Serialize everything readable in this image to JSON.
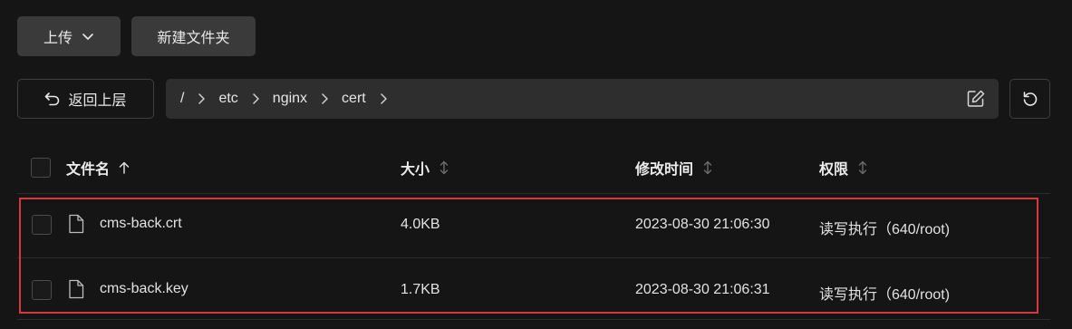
{
  "toolbar": {
    "upload_label": "上传",
    "new_folder_label": "新建文件夹"
  },
  "navigation": {
    "back_label": "返回上层",
    "breadcrumb": [
      "/",
      "etc",
      "nginx",
      "cert"
    ]
  },
  "table": {
    "headers": {
      "name": "文件名",
      "size": "大小",
      "modified": "修改时间",
      "permissions": "权限"
    },
    "rows": [
      {
        "name": "cms-back.crt",
        "size": "4.0KB",
        "modified": "2023-08-30 21:06:30",
        "permissions": "读写执行（640/root)"
      },
      {
        "name": "cms-back.key",
        "size": "1.7KB",
        "modified": "2023-08-30 21:06:31",
        "permissions": "读写执行（640/root)"
      }
    ]
  },
  "colors": {
    "background": "#151515",
    "button": "#3a3a3a",
    "path_bar": "#2e2e2e",
    "highlight_border": "#d9363e"
  }
}
